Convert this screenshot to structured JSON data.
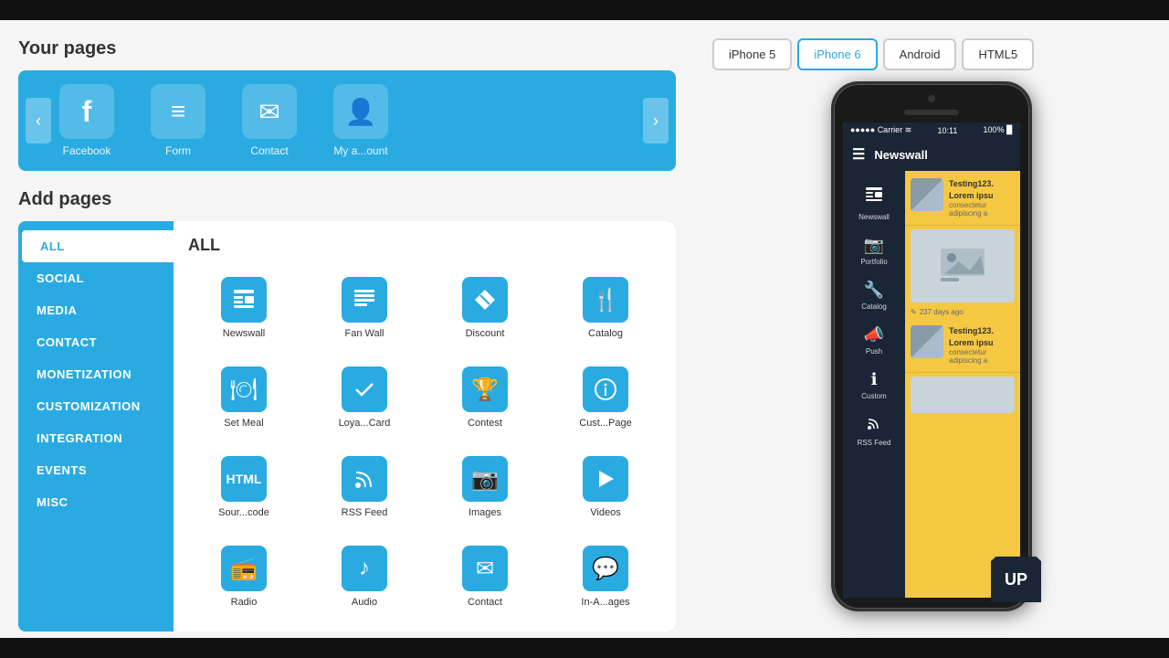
{
  "left": {
    "your_pages_title": "Your pages",
    "add_pages_title": "Add pages",
    "carousel_pages": [
      {
        "label": "Facebook",
        "icon": "f"
      },
      {
        "label": "Form",
        "icon": "≡"
      },
      {
        "label": "Contact",
        "icon": "✉"
      },
      {
        "label": "My a...ount",
        "icon": "👤"
      }
    ],
    "categories": [
      {
        "label": "ALL",
        "active": true
      },
      {
        "label": "SOCIAL"
      },
      {
        "label": "MEDIA"
      },
      {
        "label": "CONTACT"
      },
      {
        "label": "MONETIZATION"
      },
      {
        "label": "CUSTOMIZATION"
      },
      {
        "label": "INTEGRATION"
      },
      {
        "label": "EVENTS"
      },
      {
        "label": "MISC"
      }
    ],
    "grid_header": "ALL",
    "grid_items": [
      {
        "label": "Newswall",
        "icon": "📰"
      },
      {
        "label": "Fan Wall",
        "icon": "📋"
      },
      {
        "label": "Discount",
        "icon": "🏷"
      },
      {
        "label": "Catalog",
        "icon": "🍴"
      },
      {
        "label": "Set Meal",
        "icon": "🍽"
      },
      {
        "label": "Loya...Card",
        "icon": "✔"
      },
      {
        "label": "Contest",
        "icon": "🏆"
      },
      {
        "label": "Cust...Page",
        "icon": "ℹ"
      },
      {
        "label": "Sour...code",
        "icon": "H"
      },
      {
        "label": "RSS Feed",
        "icon": "📡"
      },
      {
        "label": "Images",
        "icon": "📷"
      },
      {
        "label": "Videos",
        "icon": "▶"
      },
      {
        "label": "Radio",
        "icon": "📻"
      },
      {
        "label": "Audio",
        "icon": "♪"
      },
      {
        "label": "Contact",
        "icon": "✉"
      },
      {
        "label": "In-A...ages",
        "icon": "💬"
      }
    ]
  },
  "right": {
    "device_buttons": [
      {
        "label": "iPhone 5",
        "active": false
      },
      {
        "label": "iPhone 6",
        "active": true
      },
      {
        "label": "Android",
        "active": false
      },
      {
        "label": "HTML5",
        "active": false
      }
    ],
    "phone": {
      "status_carrier": "Carrier",
      "status_time": "10:11",
      "app_title": "Newswall",
      "nav_items": [
        {
          "icon": "📰",
          "label": "Newswall"
        },
        {
          "icon": "📷",
          "label": "Portfolio"
        },
        {
          "icon": "🔧",
          "label": "Catalog"
        },
        {
          "icon": "📣",
          "label": "Push"
        },
        {
          "icon": "ℹ",
          "label": "Custom"
        },
        {
          "icon": "📡",
          "label": "RSS Feed"
        }
      ],
      "news_items": [
        {
          "title": "Testing123. Lorem ipsu",
          "sub": "consectetur adipiscing a"
        },
        {
          "timestamp": "237 days ago"
        },
        {
          "title": "Testing123. Lorem ipsu",
          "sub": "consectetur adipiscing a"
        }
      ]
    }
  }
}
